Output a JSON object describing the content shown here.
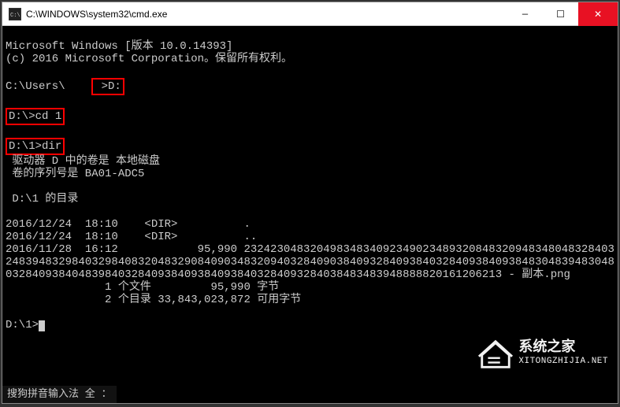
{
  "titlebar": {
    "icon_label": "cmd",
    "title": "C:\\WINDOWS\\system32\\cmd.exe",
    "minimize": "—",
    "maximize": "☐",
    "close": "✕"
  },
  "terminal": {
    "header_line1": "Microsoft Windows [版本 10.0.14393]",
    "header_line2": "(c) 2016 Microsoft Corporation。保留所有权利。",
    "prompt1_prefix": "C:\\Users\\    ",
    "prompt1_cmd": " >D:",
    "prompt2_prefix": "D:\\>",
    "prompt2_cmd": "cd 1",
    "prompt3_prefix": "D:\\1>",
    "prompt3_cmd": "dir",
    "vol_line1": " 驱动器 D 中的卷是 本地磁盘",
    "vol_line2": " 卷的序列号是 BA01-ADC5",
    "dir_of": " D:\\1 的目录",
    "row1": "2016/12/24  18:10    <DIR>          .",
    "row2": "2016/12/24  18:10    <DIR>          ..",
    "row3": "2016/11/28  16:12            95,990 2324230483204983483409234902348932084832094834804832840324839483298403298408320483290840903483209403284090384093284093840328409384093848304839483048032840938404839840328409384093840938403284093284038483483948888820161206213 - 副本.png",
    "summary1": "               1 个文件         95,990 字节",
    "summary2": "               2 个目录 33,843,023,872 可用字节",
    "final_prompt": "D:\\1>"
  },
  "watermark": {
    "line1": "系统之家",
    "line2": "XITONGZHIJIA.NET"
  },
  "ime": {
    "text": "搜狗拼音输入法 全 ："
  }
}
